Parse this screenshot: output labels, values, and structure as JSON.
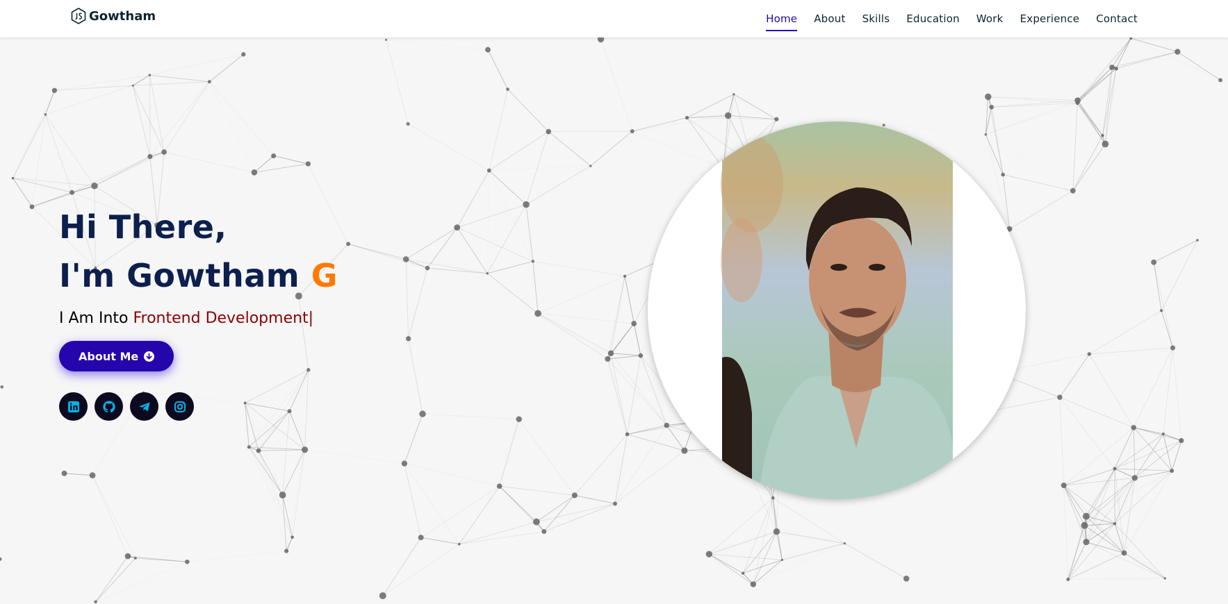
{
  "brand": {
    "name": "Gowtham",
    "icon": "js-hexagon-icon"
  },
  "nav": {
    "items": [
      {
        "label": "Home",
        "active": true
      },
      {
        "label": "About"
      },
      {
        "label": "Skills"
      },
      {
        "label": "Education"
      },
      {
        "label": "Work"
      },
      {
        "label": "Experience"
      },
      {
        "label": "Contact"
      }
    ]
  },
  "hero": {
    "greeting": "Hi There,",
    "intro": "I'm Gowtham",
    "intro_accent": "G",
    "sub_prefix": "I Am Into",
    "sub_typed": "Frontend Development",
    "cursor": "|",
    "button_label": "About Me",
    "button_icon": "arrow-down-circle-icon"
  },
  "socials": [
    {
      "name": "linkedin-icon"
    },
    {
      "name": "github-icon"
    },
    {
      "name": "telegram-icon"
    },
    {
      "name": "instagram-icon"
    }
  ],
  "colors": {
    "primary": "#2506ad",
    "heading": "#0c1f4d",
    "accent": "#ff7a00",
    "typed": "#8b0000",
    "social_bg": "#0c0a1f",
    "social_icon": "#00b4e6",
    "background": "#f6f6f6"
  },
  "profile_photo": {
    "alt": "Gowtham"
  }
}
